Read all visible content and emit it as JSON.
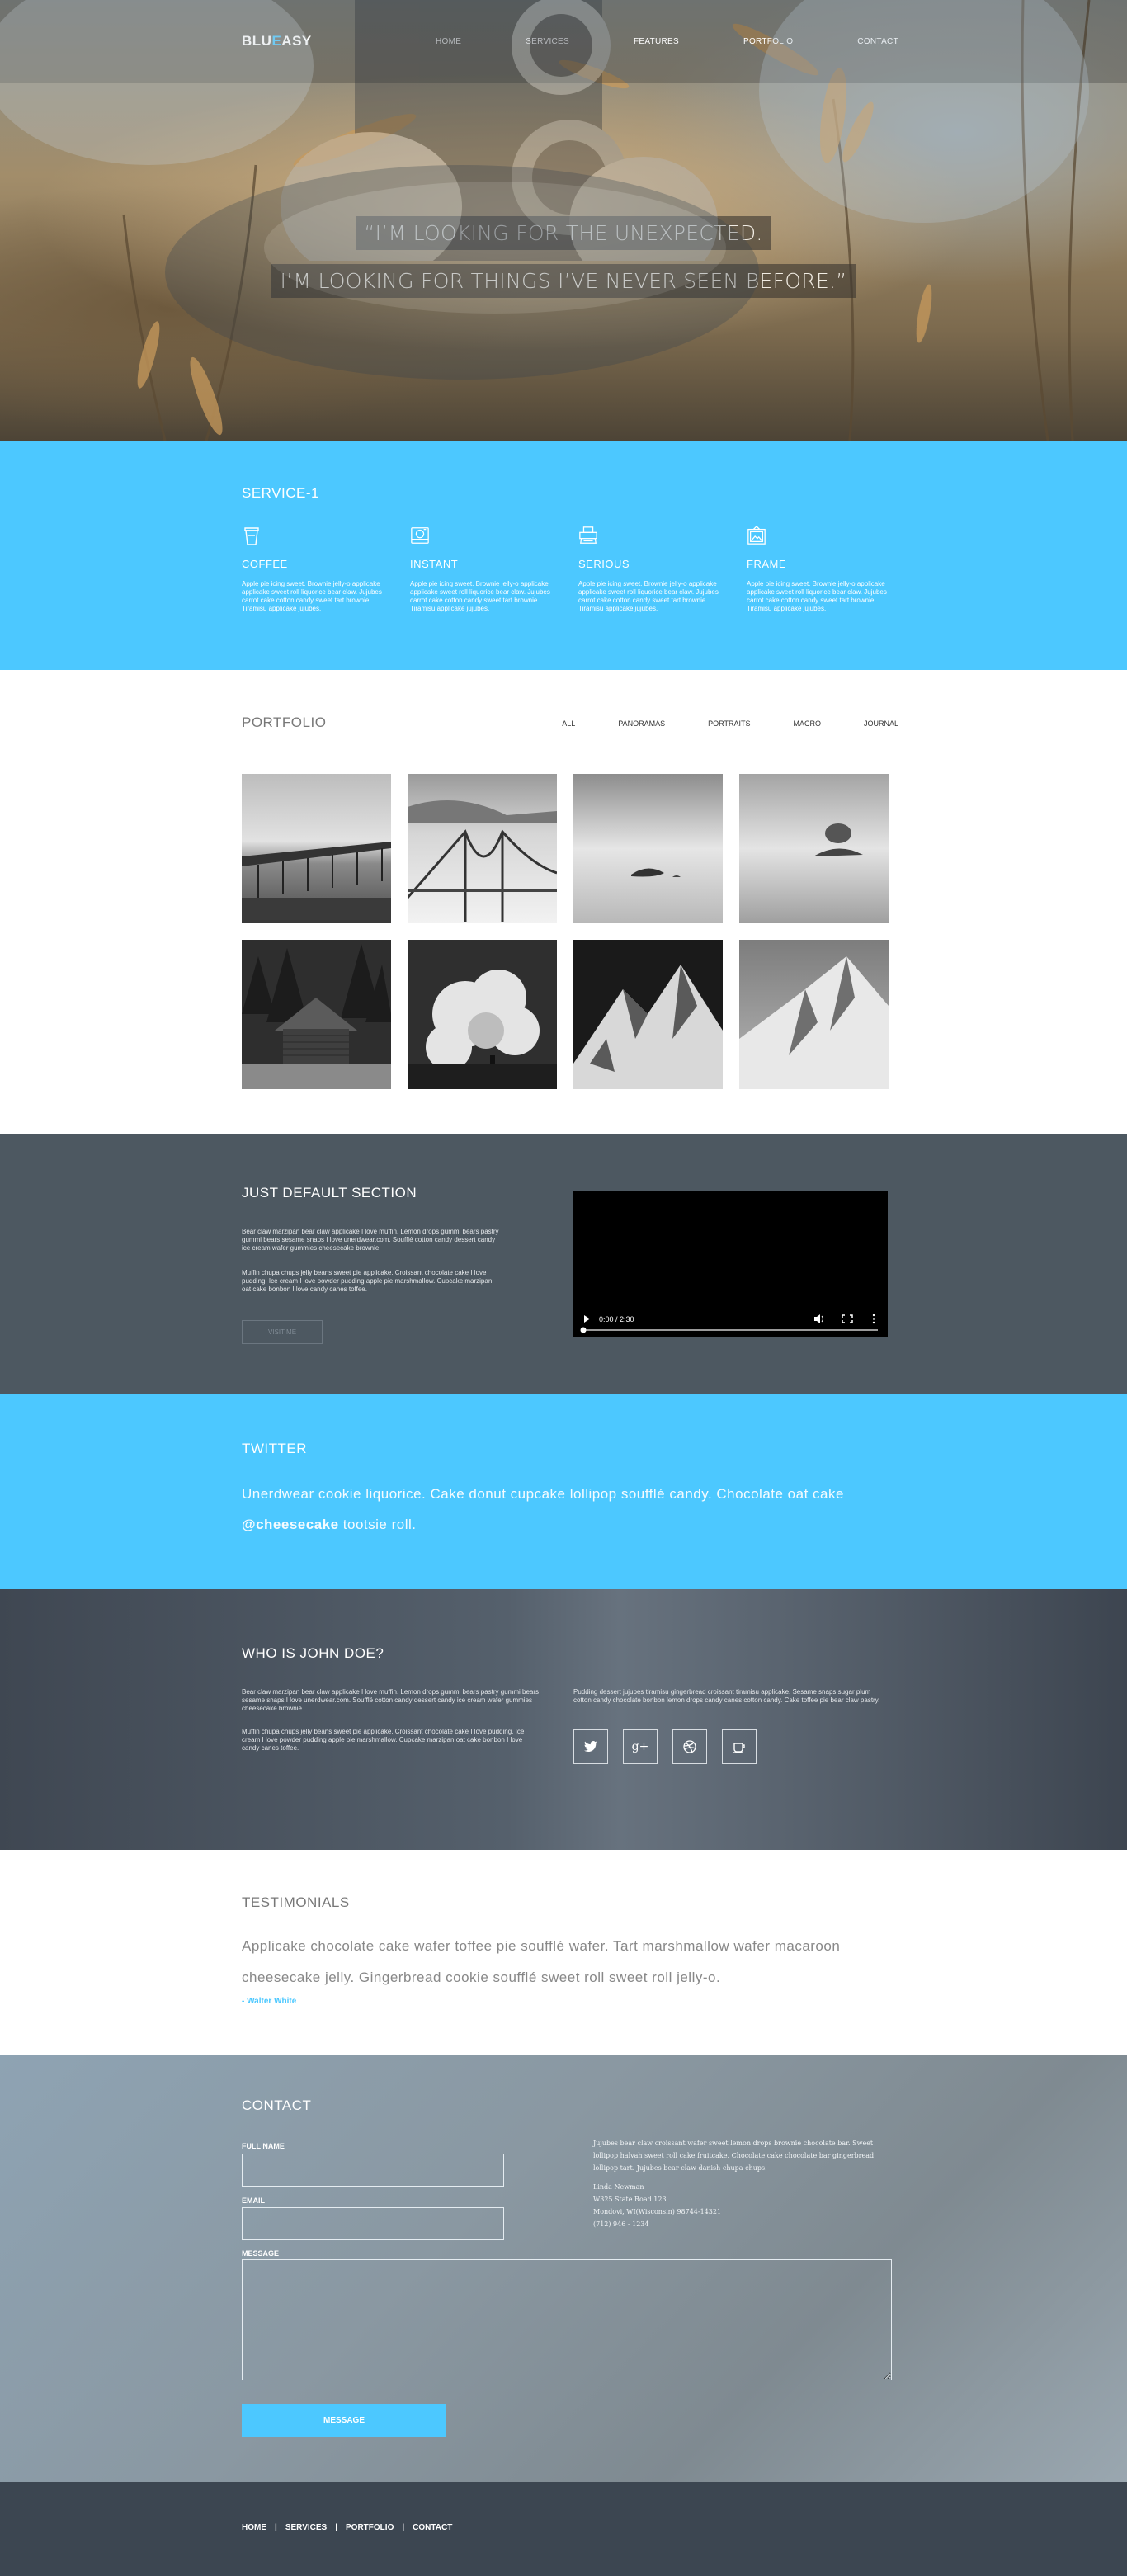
{
  "brand": {
    "part1": "BLU",
    "accent": "E",
    "part2": "ASY"
  },
  "nav": [
    "HOME",
    "SERVICES",
    "FEATURES",
    "PORTFOLIO",
    "CONTACT"
  ],
  "hero": {
    "line1": "“I’M LOOKING FOR THE UNEXPECTED.",
    "line2": "I’M LOOKING FOR THINGS I’VE NEVER SEEN BEFORE.”"
  },
  "services": {
    "title": "SERVICE-1",
    "items": [
      {
        "icon": "coffee-cup-icon",
        "title": "COFFEE",
        "text": "Apple pie icing sweet. Brownie jelly-o applicake applicake sweet roll liquorice bear claw. Jujubes carrot cake cotton candy sweet tart brownie. Tiramisu applicake jujubes."
      },
      {
        "icon": "instant-camera-icon",
        "title": "INSTANT",
        "text": "Apple pie icing sweet. Brownie jelly-o applicake applicake sweet roll liquorice bear claw. Jujubes carrot cake cotton candy sweet tart brownie. Tiramisu applicake jujubes."
      },
      {
        "icon": "typewriter-icon",
        "title": "SERIOUS",
        "text": "Apple pie icing sweet. Brownie jelly-o applicake applicake sweet roll liquorice bear claw. Jujubes carrot cake cotton candy sweet tart brownie. Tiramisu applicake jujubes."
      },
      {
        "icon": "picture-frame-icon",
        "title": "FRAME",
        "text": "Apple pie icing sweet. Brownie jelly-o applicake applicake sweet roll liquorice bear claw. Jujubes carrot cake cotton candy sweet tart brownie. Tiramisu applicake jujubes."
      }
    ]
  },
  "portfolio": {
    "title": "PORTFOLIO",
    "filters": [
      "ALL",
      "PANORAMAS",
      "PORTRAITS",
      "MACRO",
      "JOURNAL"
    ],
    "images": [
      "pier-photo",
      "bridge-photo",
      "island-photo",
      "tree-island-photo",
      "cabin-photo",
      "clouds-photo",
      "mountain-photo",
      "snowy-peak-photo"
    ]
  },
  "default_section": {
    "title": "JUST DEFAULT SECTION",
    "p1": "Bear claw marzipan bear claw applicake I love muffin. Lemon drops gummi bears pastry gummi bears sesame snaps I love unerdwear.com. Soufflé cotton candy dessert candy ice cream wafer gummies cheesecake brownie.",
    "p2": "Muffin chupa chups jelly beans sweet pie applicake. Croissant chocolate cake I love pudding. Ice cream I love powder pudding apple pie marshmallow. Cupcake marzipan oat cake bonbon I love candy canes toffee.",
    "button": "VISIT ME",
    "video_time": "0:00 / 2:30"
  },
  "twitter": {
    "title": "TWITTER",
    "text": "Unerdwear cookie liquorice. Cake donut cupcake lollipop soufflé candy. Chocolate oat cake",
    "handle": "@cheesecake",
    "text2": " tootsie roll."
  },
  "john": {
    "title": "WHO IS JOHN DOE?",
    "p1": "Bear claw marzipan bear claw applicake I love muffin. Lemon drops gummi bears pastry gummi bears sesame snaps I love unerdwear.com. Soufflé cotton candy dessert candy ice cream wafer gummies cheesecake brownie.",
    "p2": "Muffin chupa chups jelly beans sweet pie applicake. Croissant chocolate cake I love pudding. Ice cream I love powder pudding apple pie marshmallow. Cupcake marzipan oat cake bonbon I love candy canes toffee.",
    "p3": "Pudding dessert jujubes tiramisu gingerbread croissant tiramisu applicake. Sesame snaps sugar plum cotton candy chocolate bonbon lemon drops candy canes cotton candy. Cake toffee pie bear claw pastry.",
    "social": [
      {
        "icon": "twitter-icon",
        "glyph": "🐦"
      },
      {
        "icon": "google-plus-icon",
        "glyph": "g+"
      },
      {
        "icon": "dribbble-icon",
        "glyph": "◎"
      },
      {
        "icon": "coffee-icon",
        "glyph": "☕"
      }
    ]
  },
  "testimonials": {
    "title": "TESTIMONIALS",
    "text": "Applicake chocolate cake wafer toffee pie soufflé wafer. Tart marshmallow wafer macaroon cheesecake jelly. Gingerbread cookie soufflé sweet roll sweet roll jelly-o.",
    "author": "- Walter White"
  },
  "contact": {
    "title": "CONTACT",
    "name_label": "FULL NAME",
    "email_label": "EMAIL",
    "message_label": "MESSAGE",
    "button": "MESSAGE",
    "info": "Jujubes bear claw croissant wafer sweet lemon drops brownie chocolate bar. Sweet lollipop halvah sweet roll cake fruitcake. Chocolate cake chocolate bar gingerbread lollipop tart. Jujubes bear claw danish chupa chups.",
    "name": "Linda Newman",
    "street": "W325 State Road 123",
    "city": "Mondovi, WI(Wisconsin) 98744-14321",
    "phone": "(712) 946 - 1234"
  },
  "footer": [
    "HOME",
    "SERVICES",
    "PORTFOLIO",
    "CONTACT"
  ]
}
